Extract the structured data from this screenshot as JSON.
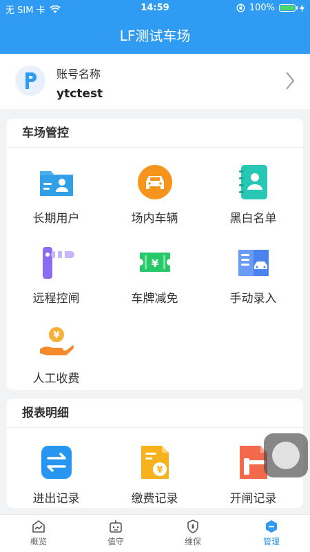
{
  "status_bar": {
    "carrier": "无 SIM 卡",
    "time": "14:59",
    "battery": "100%"
  },
  "nav": {
    "title": "LF测试车场"
  },
  "account": {
    "label": "账号名称",
    "value": "ytctest"
  },
  "section_control": {
    "title": "车场管控",
    "items": [
      {
        "label": "长期用户",
        "icon": "folder-user-icon"
      },
      {
        "label": "场内车辆",
        "icon": "car-icon"
      },
      {
        "label": "黑白名单",
        "icon": "contact-book-icon"
      },
      {
        "label": "远程控闸",
        "icon": "barrier-gate-icon"
      },
      {
        "label": "车牌减免",
        "icon": "coupon-icon"
      },
      {
        "label": "手动录入",
        "icon": "manual-entry-icon"
      },
      {
        "label": "人工收费",
        "icon": "hand-coin-icon"
      }
    ]
  },
  "section_report": {
    "title": "报表明细",
    "items": [
      {
        "label": "进出记录",
        "icon": "in-out-icon"
      },
      {
        "label": "缴费记录",
        "icon": "payment-doc-icon"
      },
      {
        "label": "开闸记录",
        "icon": "gate-record-icon"
      }
    ]
  },
  "tabbar": {
    "items": [
      {
        "label": "概览",
        "icon": "overview-icon"
      },
      {
        "label": "值守",
        "icon": "robot-icon"
      },
      {
        "label": "维保",
        "icon": "shield-icon"
      },
      {
        "label": "管理",
        "icon": "manage-icon"
      }
    ],
    "active": "管理"
  },
  "colors": {
    "primary": "#2f9bf2",
    "background": "#f2f3f5"
  }
}
